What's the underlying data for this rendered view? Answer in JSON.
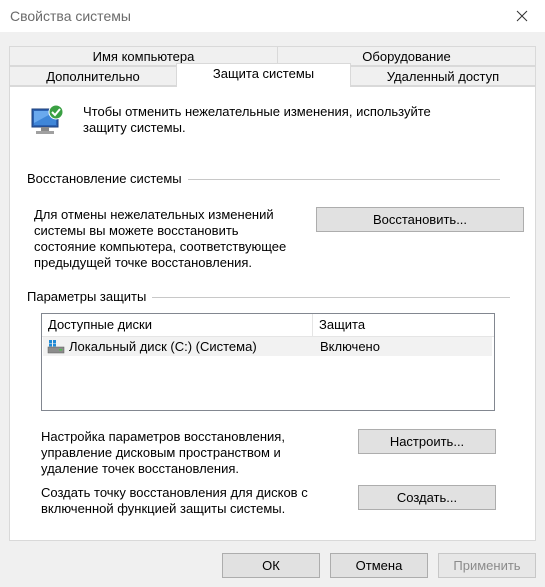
{
  "window": {
    "title": "Свойства системы"
  },
  "tabs": {
    "row1": [
      {
        "label": "Имя компьютера"
      },
      {
        "label": "Оборудование"
      }
    ],
    "row2": [
      {
        "label": "Дополнительно"
      },
      {
        "label": "Защита системы"
      },
      {
        "label": "Удаленный доступ"
      }
    ]
  },
  "intro": {
    "text_line1": "Чтобы отменить нежелательные изменения, используйте",
    "text_line2": "защиту системы.",
    "icon": "computer-shield-icon"
  },
  "restore": {
    "group_title": "Восстановление системы",
    "desc": [
      "Для отмены нежелательных изменений",
      "системы вы можете восстановить",
      "состояние компьютера, соответствующее",
      "предыдущей точке восстановления."
    ],
    "button": "Восстановить..."
  },
  "protection": {
    "group_title": "Параметры защиты",
    "columns": {
      "drives": "Доступные диски",
      "protection": "Защита"
    },
    "rows": [
      {
        "drive": "Локальный диск (C:) (Система)",
        "status": "Включено",
        "icon": "drive-icon"
      }
    ],
    "configure_desc": [
      "Настройка параметров восстановления,",
      "управление дисковым пространством и",
      "удаление точек восстановления."
    ],
    "configure_button": "Настроить...",
    "create_desc": [
      "Создать точку восстановления для дисков с",
      "включенной функцией защиты системы."
    ],
    "create_button": "Создать..."
  },
  "footer": {
    "ok": "ОК",
    "cancel": "Отмена",
    "apply": "Применить"
  }
}
